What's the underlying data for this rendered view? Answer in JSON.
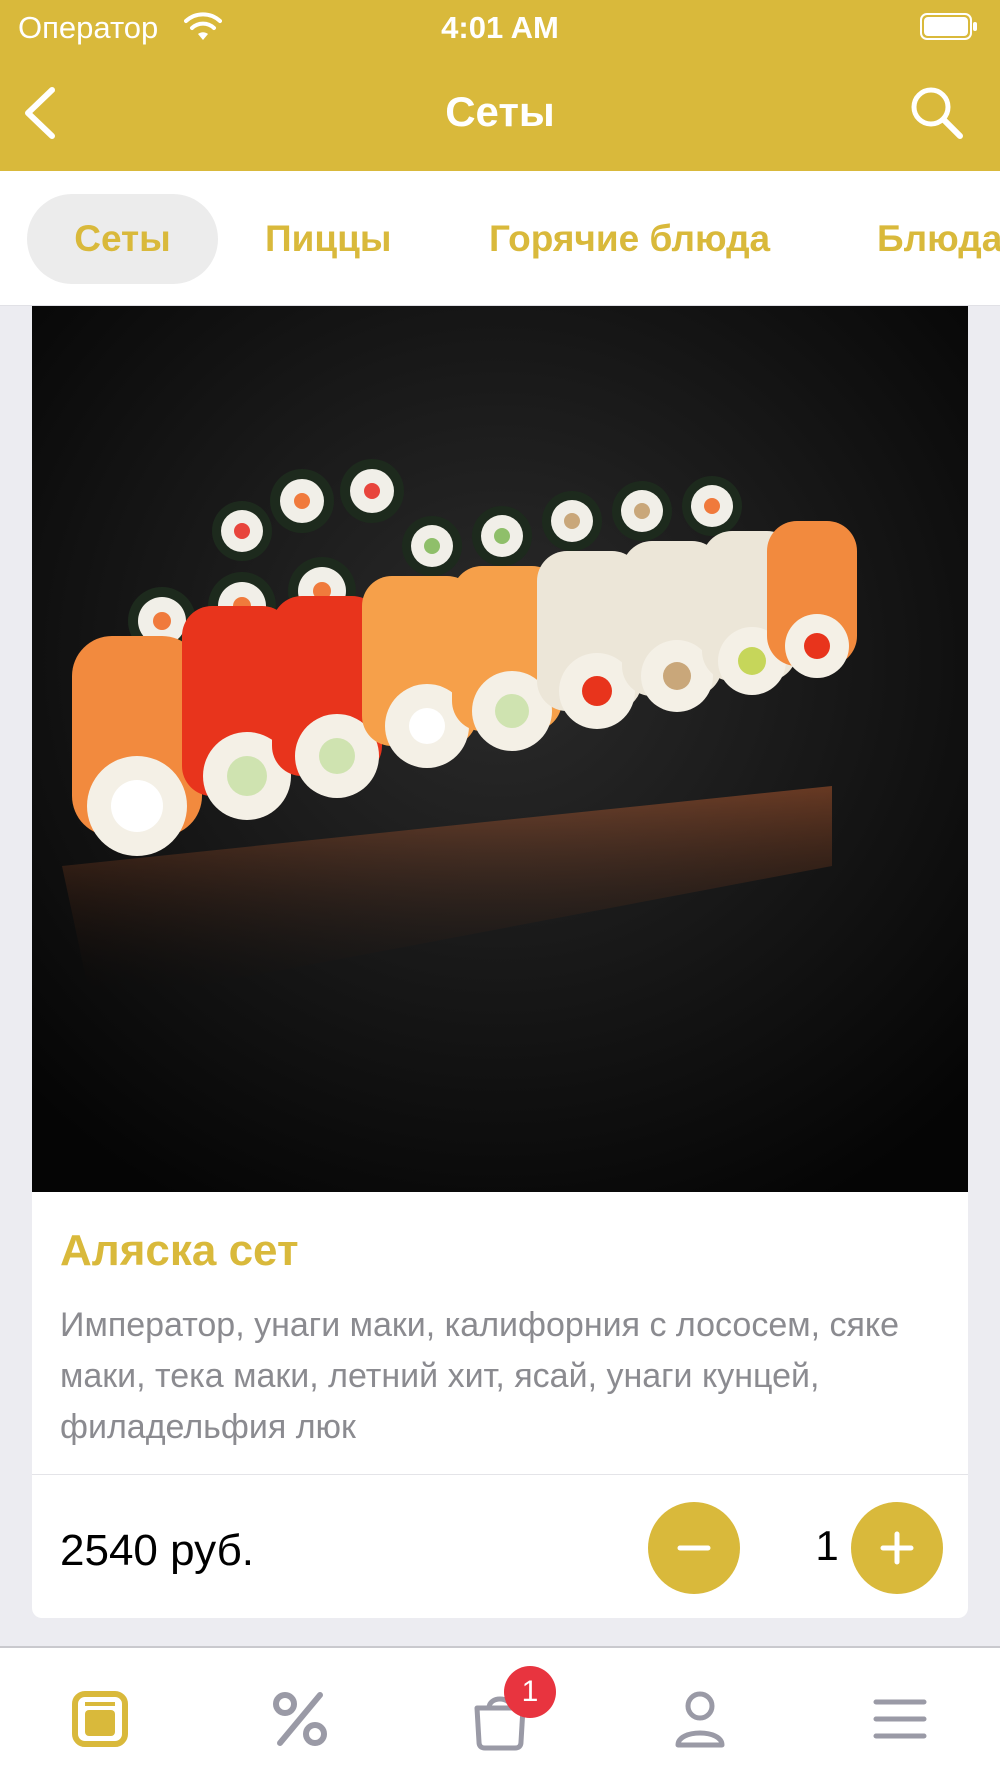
{
  "status_bar": {
    "carrier": "Оператор",
    "time": "4:01 AM"
  },
  "nav": {
    "title": "Сеты",
    "back_icon": "chevron-left-icon",
    "search_icon": "search-icon"
  },
  "category_tabs": [
    {
      "label": "Сеты",
      "active": true
    },
    {
      "label": "Пиццы",
      "active": false
    },
    {
      "label": "Горячие блюда",
      "active": false
    },
    {
      "label": "Блюда",
      "active": false
    }
  ],
  "product": {
    "image_alt_icon": "sushi-set-photo",
    "name": "Аляска сет",
    "description": "Император, унаги маки, калифорния с лососем, сяке маки, тека маки, летний хит, ясай, унаги кунцей, филадельфия люк",
    "price": "2540 руб.",
    "quantity": "1",
    "decrement_icon": "minus-icon",
    "increment_icon": "plus-icon"
  },
  "tab_bar": {
    "items": [
      {
        "icon": "menu-book-icon",
        "active": true
      },
      {
        "icon": "percent-icon",
        "active": false
      },
      {
        "icon": "cart-icon",
        "active": false
      },
      {
        "icon": "profile-icon",
        "active": false
      },
      {
        "icon": "hamburger-menu-icon",
        "active": false
      }
    ],
    "cart_badge": "1"
  },
  "colors": {
    "accent": "#d9b93b",
    "badge": "#e8343f",
    "inactive_icon": "#9a9aa6",
    "description_text": "#8b8b90"
  }
}
